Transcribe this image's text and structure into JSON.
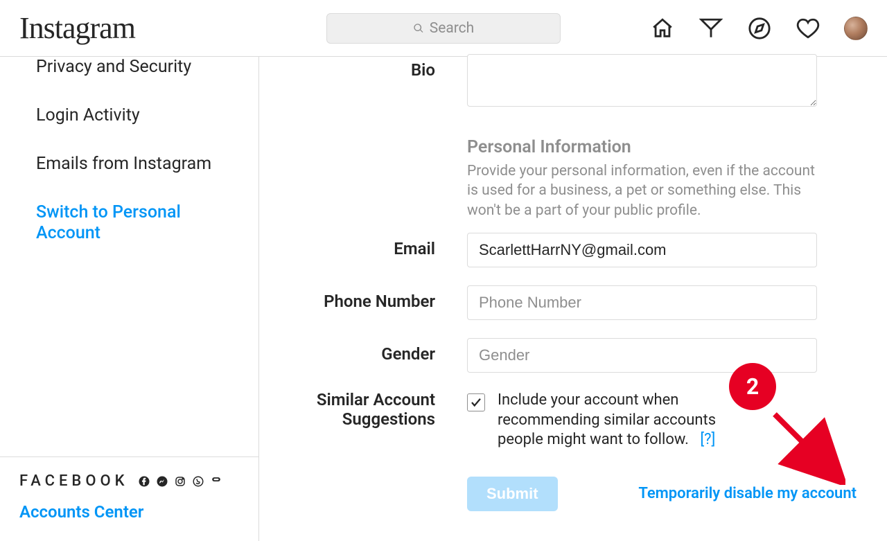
{
  "brand": "Instagram",
  "search": {
    "placeholder": "Search"
  },
  "sidebar": {
    "items": [
      {
        "label": "Privacy and Security"
      },
      {
        "label": "Login Activity"
      },
      {
        "label": "Emails from Instagram"
      },
      {
        "label": "Switch to Personal Account"
      }
    ],
    "footer": {
      "facebook_label": "FACEBOOK",
      "accounts_center": "Accounts Center"
    }
  },
  "form": {
    "bio_label": "Bio",
    "bio_value": "",
    "pi_heading": "Personal Information",
    "pi_desc": "Provide your personal information, even if the account is used for a business, a pet or something else. This won't be a part of your public profile.",
    "email_label": "Email",
    "email_value": "ScarlettHarrNY@gmail.com",
    "phone_label": "Phone Number",
    "phone_placeholder": "Phone Number",
    "phone_value": "",
    "gender_label": "Gender",
    "gender_placeholder": "Gender",
    "gender_value": "",
    "similar_label": "Similar Account Suggestions",
    "similar_text": "Include your account when recommending similar accounts people might want to follow.",
    "similar_help": "[?]",
    "similar_checked": true,
    "submit_label": "Submit",
    "disable_label": "Temporarily disable my account"
  },
  "annotation": {
    "badge": "2"
  }
}
